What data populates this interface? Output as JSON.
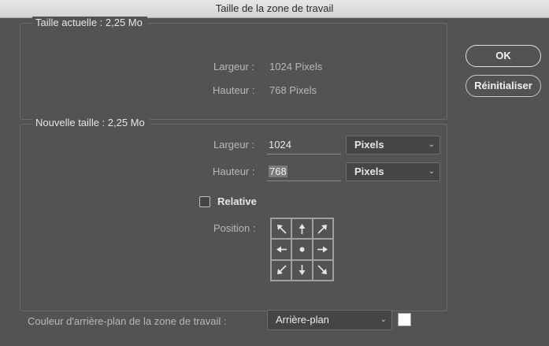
{
  "window": {
    "title": "Taille de la zone de travail"
  },
  "current_size": {
    "legend": "Taille actuelle : 2,25 Mo",
    "width_label": "Largeur :",
    "width_value": "1024 Pixels",
    "height_label": "Hauteur :",
    "height_value": "768 Pixels"
  },
  "new_size": {
    "legend": "Nouvelle taille : 2,25 Mo",
    "width_label": "Largeur :",
    "width_value": "1024",
    "width_unit": "Pixels",
    "height_label": "Hauteur :",
    "height_value": "768",
    "height_unit": "Pixels",
    "relative_label": "Relative",
    "relative_checked": false,
    "position_label": "Position :",
    "anchor_selected": "center",
    "anchor_icons": [
      "arrow-up-left-icon",
      "arrow-up-icon",
      "arrow-up-right-icon",
      "arrow-left-icon",
      "anchor-center-dot-icon",
      "arrow-right-icon",
      "arrow-down-left-icon",
      "arrow-down-icon",
      "arrow-down-right-icon"
    ]
  },
  "background": {
    "label": "Couleur d'arrière-plan de la zone de travail :",
    "value": "Arrière-plan",
    "swatch_color": "#ffffff"
  },
  "buttons": {
    "ok": "OK",
    "reset": "Réinitialiser"
  },
  "icons": {
    "dropdown": "chevron-down-icon"
  }
}
